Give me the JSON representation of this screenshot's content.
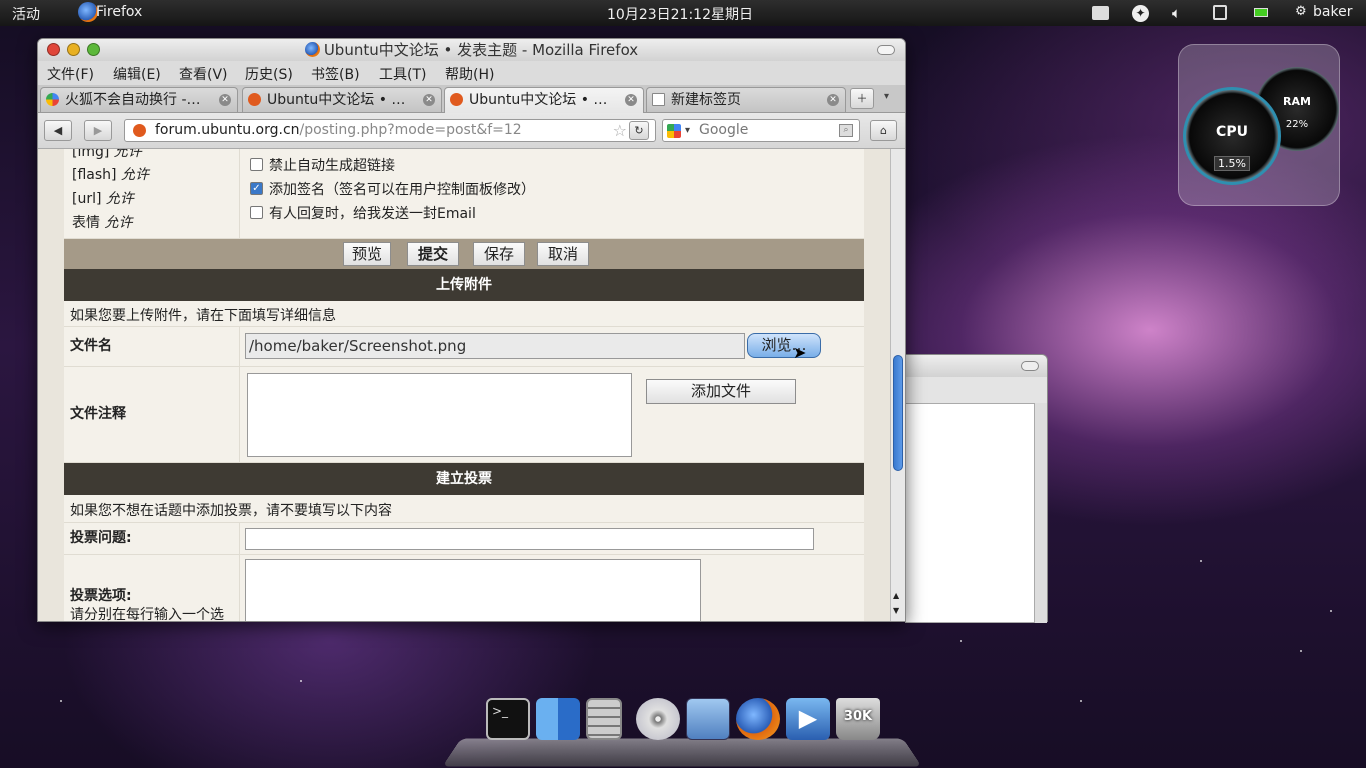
{
  "topbar": {
    "activities": "活动",
    "app": "Firefox",
    "clock": "10月23日21:12星期日",
    "user": "baker"
  },
  "window": {
    "title": "Ubuntu中文论坛 • 发表主题 - Mozilla Firefox"
  },
  "menu": [
    "文件(F)",
    "编辑(E)",
    "查看(V)",
    "历史(S)",
    "书签(B)",
    "工具(T)",
    "帮助(H)"
  ],
  "tabs": [
    {
      "label": "火狐不会自动换行 -…"
    },
    {
      "label": "Ubuntu中文论坛 • …"
    },
    {
      "label": "Ubuntu中文论坛 • …"
    },
    {
      "label": "新建标签页"
    }
  ],
  "nav": {
    "url_host": "forum.ubuntu.org.cn",
    "url_path": "/posting.php?mode=post&f=12",
    "search_placeholder": "Google"
  },
  "perms": {
    "img": "[img]",
    "img_val": "允许",
    "flash": "[flash]",
    "flash_val": "允许",
    "url": "[url]",
    "url_val": "允许",
    "smilies": "表情",
    "smilies_val": "允许"
  },
  "options": {
    "no_links": "禁止自动生成超链接",
    "signature": "添加签名（签名可以在用户控制面板修改）",
    "email": "有人回复时，给我发送一封Email"
  },
  "buttons": {
    "preview": "预览",
    "submit": "提交",
    "save": "保存",
    "cancel": "取消"
  },
  "upload": {
    "header": "上传附件",
    "info": "如果您要上传附件，请在下面填写详细信息",
    "filename_label": "文件名",
    "filename_value": "/home/baker/Screenshot.png",
    "browse": "浏览…",
    "comment_label": "文件注释",
    "add_file": "添加文件"
  },
  "poll": {
    "header": "建立投票",
    "info": "如果您不想在话题中添加投票，请不要填写以下内容",
    "question_label": "投票问题:",
    "options_label": "投票选项:",
    "options_hint": "请分别在每行输入一个选"
  },
  "gadget": {
    "cpu_label": "CPU",
    "cpu_value": "1.5%",
    "ram_label": "RAM",
    "ram_value": "22%"
  },
  "dock": {
    "trash_size": "30K"
  }
}
